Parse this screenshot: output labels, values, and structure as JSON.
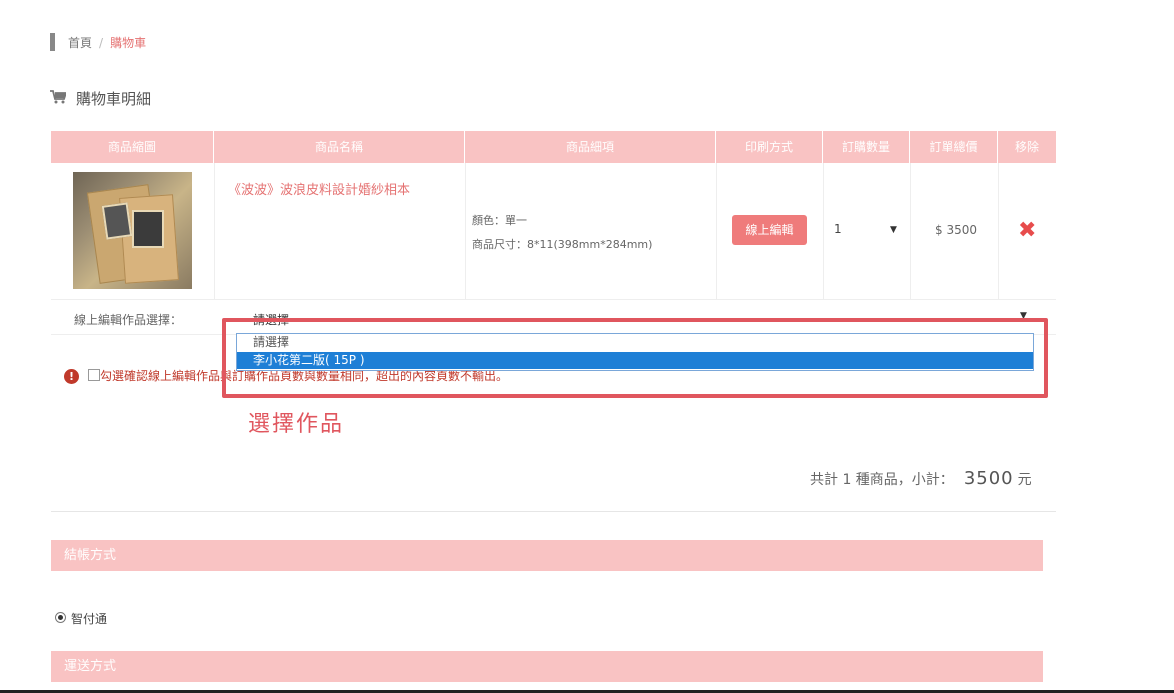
{
  "breadcrumb": {
    "home": "首頁",
    "separator": "/",
    "current": "購物車"
  },
  "section_title": "購物車明細",
  "table": {
    "headers": [
      "商品縮圖",
      "商品名稱",
      "商品細項",
      "印刷方式",
      "訂購數量",
      "訂單總價",
      "移除"
    ],
    "row": {
      "name": "《波波》波浪皮料設計婚紗相本",
      "spec_color": "顏色：單一",
      "spec_size": "商品尺寸：8*11(398mm*284mm)",
      "print_button": "線上編輯",
      "quantity": "1",
      "total": "$ 3500",
      "remove_icon": "✖"
    }
  },
  "work_select": {
    "label": "線上編輯作品選擇：",
    "current": "請選擇",
    "options": [
      "請選擇",
      "李小花第二版( 15P )"
    ],
    "selected_index": 1
  },
  "annotation": "選擇作品",
  "confirm": {
    "icon": "!",
    "text": "勾選確認線上編輯作品與訂購作品頁數與數量相同，超出的內容頁數不輸出。"
  },
  "summary": {
    "prefix": "共計 1 種商品，小計：",
    "amount": "3500",
    "unit": "元"
  },
  "checkout": {
    "title": "結帳方式",
    "option": "智付通"
  },
  "shipping": {
    "title": "運送方式"
  },
  "colors": {
    "accent": "#f9c3c3",
    "button": "#ef7b7b",
    "highlight": "#e0565e",
    "link": "#e57373"
  }
}
